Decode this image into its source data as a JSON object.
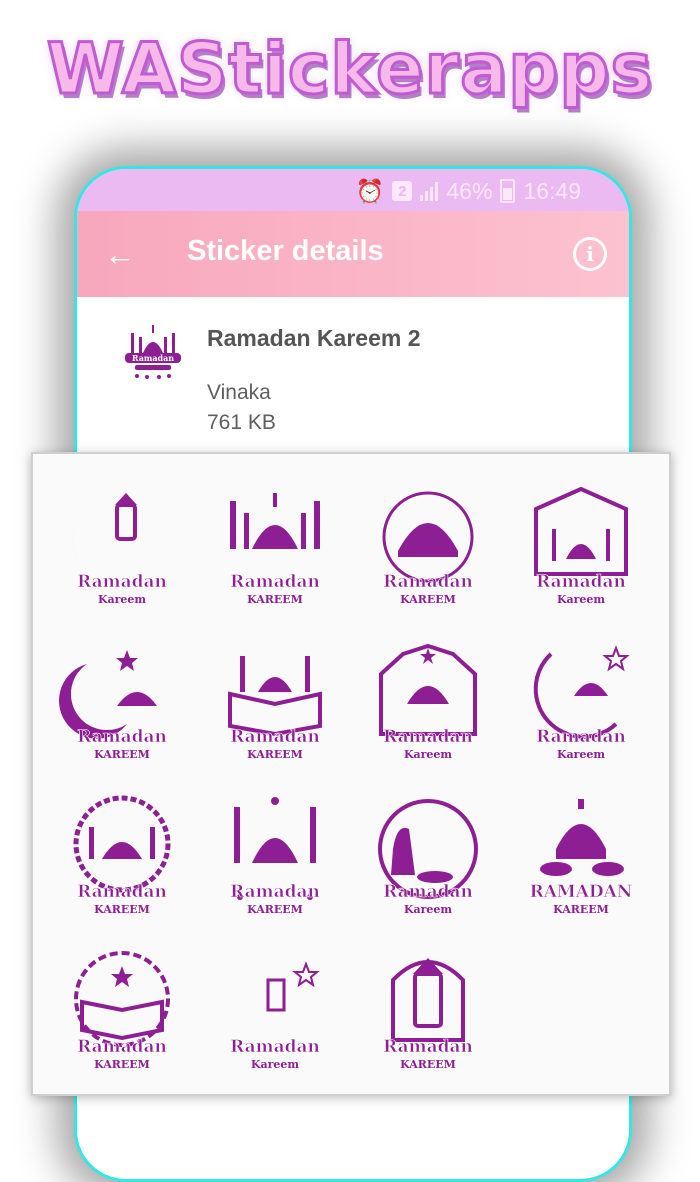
{
  "banner": {
    "title": "WAStickerapps"
  },
  "status_bar": {
    "sim": "2",
    "battery": "46%",
    "time": "16:49"
  },
  "toolbar": {
    "title": "Sticker details"
  },
  "pack": {
    "name": "Ramadan Kareem 2",
    "publisher": "Vinaka",
    "size": "761 KB"
  },
  "colors": {
    "sticker": "#8e1e93",
    "toolbar_start": "#f8a7bd",
    "status": "#ecbaf3"
  },
  "stickers": [
    {
      "top": "Ramadan",
      "bottom": "Kareem"
    },
    {
      "top": "Ramadan",
      "bottom": "KAREEM"
    },
    {
      "top": "Ramadan",
      "bottom": "KAREEM"
    },
    {
      "top": "Ramadan",
      "bottom": "Kareem"
    },
    {
      "top": "Ramadan",
      "bottom": "KAREEM"
    },
    {
      "top": "Ramadan",
      "bottom": "KAREEM"
    },
    {
      "top": "Ramadan",
      "bottom": "Kareem"
    },
    {
      "top": "Ramadan",
      "bottom": "Kareem"
    },
    {
      "top": "Ramadan",
      "bottom": "KAREEM"
    },
    {
      "top": "Ramadan",
      "bottom": "KAREEM"
    },
    {
      "top": "Ramadan",
      "bottom": "Kareem"
    },
    {
      "top": "RAMADAN",
      "bottom": "KAREEM"
    },
    {
      "top": "Ramadan",
      "bottom": "KAREEM"
    },
    {
      "top": "Ramadan",
      "bottom": "Kareem"
    },
    {
      "top": "Ramadan",
      "bottom": "KAREEM"
    }
  ]
}
